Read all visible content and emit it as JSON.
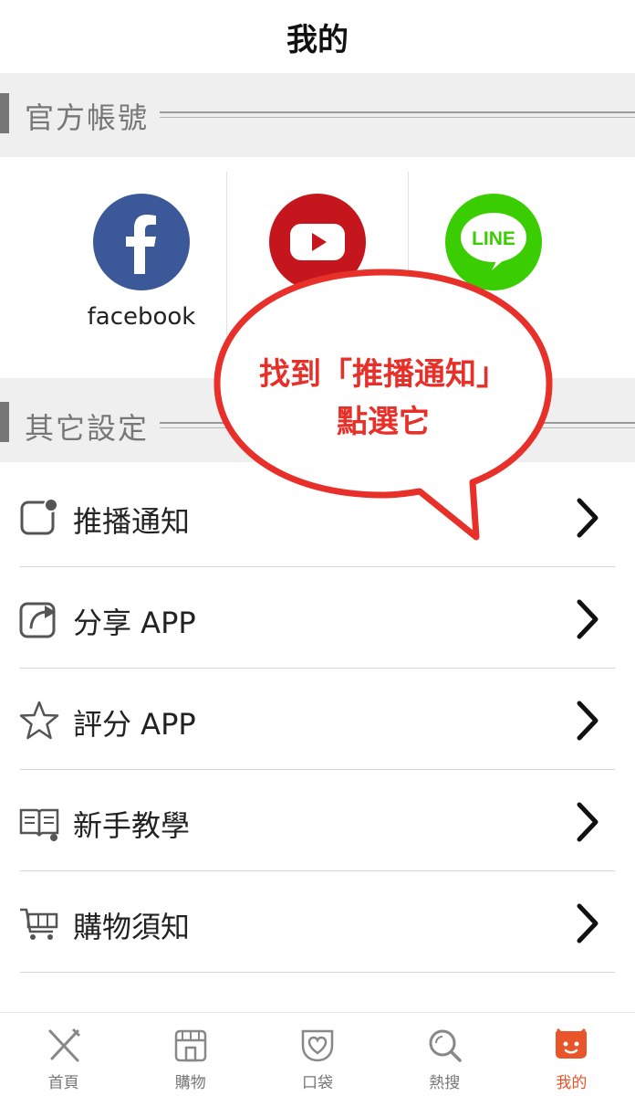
{
  "header": {
    "title": "我的"
  },
  "sections": {
    "official": {
      "label": "官方帳號"
    },
    "other": {
      "label": "其它設定"
    }
  },
  "social": [
    {
      "name": "facebook",
      "label": "facebook",
      "color": "#3b5998",
      "icon": "facebook-icon"
    },
    {
      "name": "youtube",
      "label": "",
      "color": "#c4161c",
      "icon": "youtube-icon"
    },
    {
      "name": "line",
      "label": "",
      "color": "#3acd01",
      "icon": "line-icon",
      "badge": "LINE"
    }
  ],
  "callout": {
    "line1": "找到「推播通知」",
    "line2": "點選它",
    "color": "#e8302a"
  },
  "menu": [
    {
      "label": "推播通知",
      "icon": "notification-icon"
    },
    {
      "label": "分享 APP",
      "icon": "share-icon"
    },
    {
      "label": "評分 APP",
      "icon": "star-icon"
    },
    {
      "label": "新手教學",
      "icon": "book-icon"
    },
    {
      "label": "購物須知",
      "icon": "cart-icon"
    }
  ],
  "tabs": [
    {
      "label": "首頁",
      "icon": "utensils-icon"
    },
    {
      "label": "購物",
      "icon": "store-icon"
    },
    {
      "label": "口袋",
      "icon": "heart-icon"
    },
    {
      "label": "熱搜",
      "icon": "search-icon"
    },
    {
      "label": "我的",
      "icon": "smile-icon",
      "active": true
    }
  ],
  "colors": {
    "accent": "#e8552a",
    "section_bg": "#efefef",
    "text": "#222222"
  }
}
